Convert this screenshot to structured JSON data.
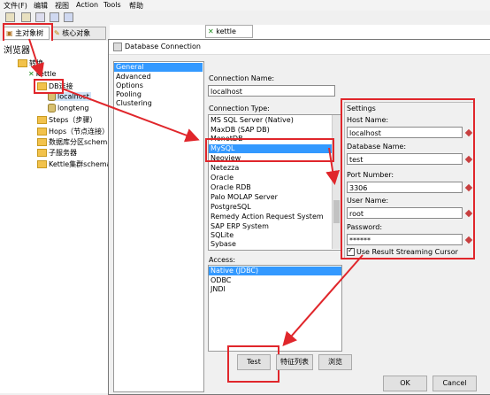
{
  "menu": [
    "文件(F)",
    "编辑",
    "视图",
    "Action",
    "Tools",
    "帮助"
  ],
  "left_tabs": {
    "main_tree": "主对象树",
    "core_objects": "核心对象"
  },
  "editor_tab": "kettle",
  "browser": {
    "title": "浏览器",
    "items": [
      "转换",
      "kettle",
      "DB连接",
      "localhost",
      "longteng",
      "Steps（步骤）",
      "Hops（节点连接）",
      "数据库分区schemas",
      "子服务器",
      "Kettle集群schemas"
    ]
  },
  "dialog": {
    "title": "Database Connection",
    "side_nav": [
      "General",
      "Advanced",
      "Options",
      "Pooling",
      "Clustering"
    ],
    "connection_name_label": "Connection Name:",
    "connection_name": "localhost",
    "connection_type_label": "Connection Type:",
    "connection_types": [
      "MS SQL Server (Native)",
      "MaxDB (SAP DB)",
      "MonetDB",
      "MySQL",
      "Neoview",
      "Netezza",
      "Oracle",
      "Oracle RDB",
      "Palo MOLAP Server",
      "PostgreSQL",
      "Remedy Action Request System",
      "SAP ERP System",
      "SQLite",
      "Sybase"
    ],
    "access_label": "Access:",
    "access_types": [
      "Native (JDBC)",
      "ODBC",
      "JNDI"
    ],
    "settings": {
      "title": "Settings",
      "host_label": "Host Name:",
      "host": "localhost",
      "db_label": "Database Name:",
      "db": "test",
      "port_label": "Port Number:",
      "port": "3306",
      "user_label": "User Name:",
      "user": "root",
      "password_label": "Password:",
      "password": "******",
      "streaming_label": "Use Result Streaming Cursor"
    },
    "buttons": {
      "test": "Test",
      "features": "特征列表",
      "browse": "浏览",
      "ok": "OK",
      "cancel": "Cancel"
    }
  }
}
